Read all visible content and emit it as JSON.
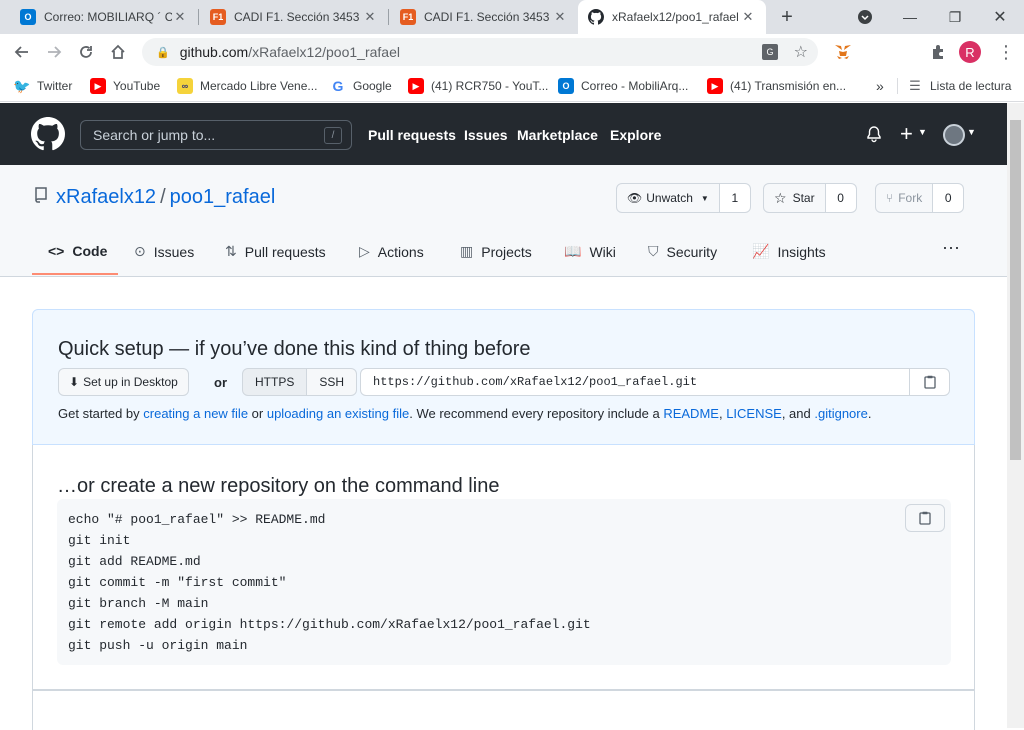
{
  "browser": {
    "tabs": [
      {
        "title": "Correo: MOBILIARQ ´ C.A",
        "icon": "outlook-icon",
        "color": "#0078d4"
      },
      {
        "title": "CADI F1. Sección 3453",
        "icon": "f1-icon",
        "color": "#e55c20"
      },
      {
        "title": "CADI F1. Sección 3453",
        "icon": "f1-icon",
        "color": "#e55c20"
      },
      {
        "title": "xRafaelx12/poo1_rafael",
        "icon": "github-icon",
        "color": "#24292f"
      }
    ],
    "address": {
      "host": "github.com",
      "path": "/xRafaelx12/poo1_rafael"
    },
    "profile_initial": "R",
    "bookmarks": [
      {
        "label": "Twitter",
        "icon": "twitter-icon",
        "color": "#1d9bf0"
      },
      {
        "label": "YouTube",
        "icon": "youtube-icon",
        "color": "#ff0000"
      },
      {
        "label": "Mercado Libre Vene...",
        "icon": "mercadolibre-icon",
        "color": "#f5d33b"
      },
      {
        "label": "Google",
        "icon": "google-icon",
        "color": "#4285f4"
      },
      {
        "label": "(41) RCR750 - YouT...",
        "icon": "youtube-icon",
        "color": "#ff0000"
      },
      {
        "label": "Correo - MobiliArq...",
        "icon": "outlook-icon",
        "color": "#0078d4"
      },
      {
        "label": "(41) Transmisión en...",
        "icon": "youtube-icon",
        "color": "#ff0000"
      }
    ],
    "reading_list": "Lista de lectura"
  },
  "github": {
    "search_placeholder": "Search or jump to...",
    "search_key": "/",
    "nav": [
      "Pull requests",
      "Issues",
      "Marketplace",
      "Explore"
    ]
  },
  "repo": {
    "owner": "xRafaelx12",
    "separator": "/",
    "name": "poo1_rafael",
    "unwatch_label": "Unwatch",
    "watch_count": "1",
    "star_label": "Star",
    "star_count": "0",
    "fork_label": "Fork",
    "fork_count": "0",
    "tabs": [
      "Code",
      "Issues",
      "Pull requests",
      "Actions",
      "Projects",
      "Wiki",
      "Security",
      "Insights"
    ]
  },
  "quick_setup": {
    "title": "Quick setup — if you’ve done this kind of thing before",
    "desktop_label": "Set up in Desktop",
    "or_label": "or",
    "https_label": "HTTPS",
    "ssh_label": "SSH",
    "clone_url": "https://github.com/xRafaelx12/poo1_rafael.git",
    "help": {
      "p1": "Get started by ",
      "link1": "creating a new file",
      "p2": " or ",
      "link2": "uploading an existing file",
      "p3": ". We recommend every repository include a ",
      "link3": "README",
      "p4": ", ",
      "link4": "LICENSE",
      "p5": ", and ",
      "link5": ".gitignore",
      "p6": "."
    }
  },
  "command_line": {
    "title": "…or create a new repository on the command line",
    "lines": [
      "echo \"# poo1_rafael\" >> README.md",
      "git init",
      "git add README.md",
      "git commit -m \"first commit\"",
      "git branch -M main",
      "git remote add origin https://github.com/xRafaelx12/poo1_rafael.git",
      "git push -u origin main"
    ]
  }
}
